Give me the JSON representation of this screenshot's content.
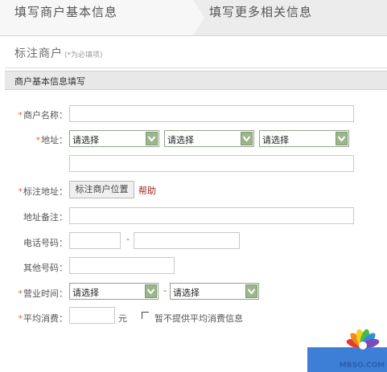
{
  "steps": [
    {
      "label": "填写商户基本信息"
    },
    {
      "label": "填写更多相关信息"
    }
  ],
  "section": {
    "title": "标注商户",
    "note": "(*为必填项)"
  },
  "subheader": "商户基本信息填写",
  "required_mark": "*",
  "fields": {
    "name": {
      "label": "商户名称：",
      "value": ""
    },
    "address": {
      "label": "地址：",
      "province": "请选择",
      "city": "请选择",
      "district": "请选择",
      "detail": ""
    },
    "mark_address": {
      "label": "标注地址：",
      "button": "标注商户位置",
      "help": "帮助"
    },
    "address_note": {
      "label": "地址备注：",
      "value": ""
    },
    "phone": {
      "label": "电话号码：",
      "area": "",
      "separator": "-",
      "number": ""
    },
    "other_phone": {
      "label": "其他号码：",
      "value": ""
    },
    "hours": {
      "label": "营业时间：",
      "start": "请选择",
      "separator": "-",
      "end": "请选择"
    },
    "avg_cost": {
      "label": "平均消费：",
      "value": "",
      "unit": "元",
      "no_avg_label": "暂不提供平均消费信息",
      "no_avg_checked": false
    }
  },
  "watermark": "MBSO.COM",
  "colors": {
    "required": "#d96a3c",
    "help_link": "#a32020",
    "select_button": "#9db58c",
    "submit": "#3d7fd6"
  }
}
